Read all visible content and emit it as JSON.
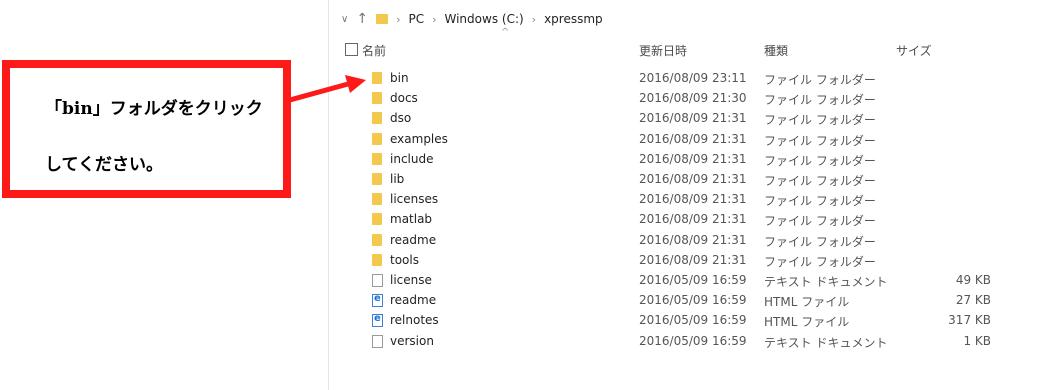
{
  "address_bar": {
    "breadcrumbs": [
      "PC",
      "Windows (C:)",
      "xpressmp"
    ]
  },
  "columns": {
    "name": "名前",
    "date": "更新日時",
    "type": "種類",
    "size": "サイズ"
  },
  "files": [
    {
      "name": "bin",
      "date": "2016/08/09 23:11",
      "type": "ファイル フォルダー",
      "size": "",
      "icon": "folder-icon"
    },
    {
      "name": "docs",
      "date": "2016/08/09 21:30",
      "type": "ファイル フォルダー",
      "size": "",
      "icon": "folder-icon"
    },
    {
      "name": "dso",
      "date": "2016/08/09 21:31",
      "type": "ファイル フォルダー",
      "size": "",
      "icon": "folder-icon"
    },
    {
      "name": "examples",
      "date": "2016/08/09 21:31",
      "type": "ファイル フォルダー",
      "size": "",
      "icon": "folder-icon"
    },
    {
      "name": "include",
      "date": "2016/08/09 21:31",
      "type": "ファイル フォルダー",
      "size": "",
      "icon": "folder-icon"
    },
    {
      "name": "lib",
      "date": "2016/08/09 21:31",
      "type": "ファイル フォルダー",
      "size": "",
      "icon": "folder-icon"
    },
    {
      "name": "licenses",
      "date": "2016/08/09 21:31",
      "type": "ファイル フォルダー",
      "size": "",
      "icon": "folder-icon"
    },
    {
      "name": "matlab",
      "date": "2016/08/09 21:31",
      "type": "ファイル フォルダー",
      "size": "",
      "icon": "folder-icon"
    },
    {
      "name": "readme",
      "date": "2016/08/09 21:31",
      "type": "ファイル フォルダー",
      "size": "",
      "icon": "folder-icon"
    },
    {
      "name": "tools",
      "date": "2016/08/09 21:31",
      "type": "ファイル フォルダー",
      "size": "",
      "icon": "folder-icon"
    },
    {
      "name": "license",
      "date": "2016/05/09 16:59",
      "type": "テキスト ドキュメント",
      "size": "49 KB",
      "icon": "text-document-icon"
    },
    {
      "name": "readme",
      "date": "2016/05/09 16:59",
      "type": "HTML ファイル",
      "size": "27 KB",
      "icon": "html-file-icon"
    },
    {
      "name": "relnotes",
      "date": "2016/05/09 16:59",
      "type": "HTML ファイル",
      "size": "317 KB",
      "icon": "html-file-icon"
    },
    {
      "name": "version",
      "date": "2016/05/09 16:59",
      "type": "テキスト ドキュメント",
      "size": "1 KB",
      "icon": "text-document-icon"
    }
  ],
  "callout": {
    "line1": "「bin」フォルダをクリック",
    "line2": "してください。",
    "border_color": "#ff1a1a"
  }
}
